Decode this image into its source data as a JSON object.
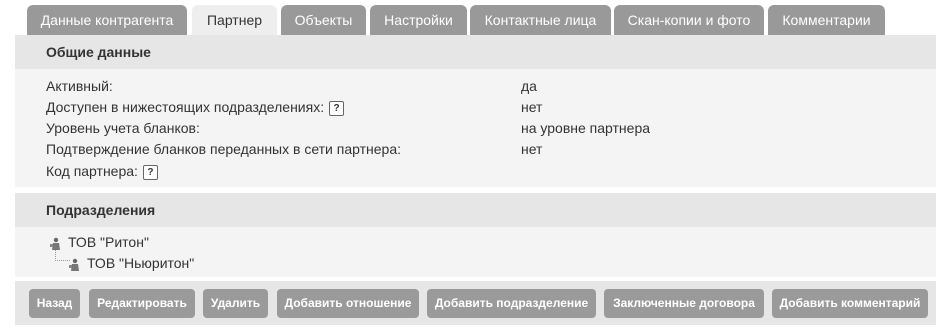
{
  "tabs": [
    {
      "label": "Данные контрагента",
      "active": false
    },
    {
      "label": "Партнер",
      "active": true
    },
    {
      "label": "Объекты",
      "active": false
    },
    {
      "label": "Настройки",
      "active": false
    },
    {
      "label": "Контактные лица",
      "active": false
    },
    {
      "label": "Скан-копии и фото",
      "active": false
    },
    {
      "label": "Комментарии",
      "active": false
    }
  ],
  "general": {
    "title": "Общие данные",
    "help_glyph": "?",
    "rows": [
      {
        "label": "Активный:",
        "value": "да"
      },
      {
        "label": "Доступен в нижестоящих подразделениях:",
        "value": "нет"
      },
      {
        "label": "Уровень учета бланков:",
        "value": "на уровне партнера"
      },
      {
        "label": "Подтверждение бланков переданных в сети партнера:",
        "value": "нет"
      },
      {
        "label": "Код партнера:",
        "value": ""
      }
    ]
  },
  "divisions": {
    "title": "Подразделения",
    "tree": [
      {
        "label": "ТОВ \"Ритон\"",
        "level": 0
      },
      {
        "label": "ТОВ \"Ньюритон\"",
        "level": 1
      }
    ]
  },
  "buttons": {
    "back": "Назад",
    "edit": "Редактировать",
    "delete": "Удалить",
    "add_relation": "Добавить отношение",
    "add_division": "Добавить подразделение",
    "contracts": "Заключенные договора",
    "add_comment": "Добавить комментарий"
  },
  "colors": {
    "tab_inactive": "#999999",
    "tab_active": "#eeeeee",
    "panel_header": "#e6e6e6",
    "panel_body": "#f4f4f4",
    "button": "#9a9a9a"
  },
  "icons": {
    "help": "help-icon",
    "tree_node": "tree-node-icon"
  }
}
